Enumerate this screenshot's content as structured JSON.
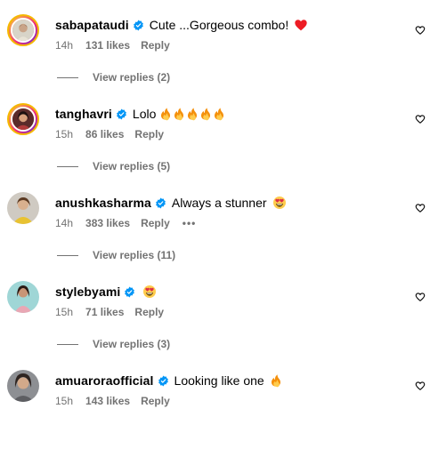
{
  "comments": [
    {
      "username": "sabapataudi",
      "text": "Cute ...Gorgeous combo!",
      "emojis": [
        "red-heart"
      ],
      "time": "14h",
      "likes": "131 likes",
      "reply": "Reply",
      "view_replies": "View replies (2)"
    },
    {
      "username": "tanghavri",
      "text": "Lolo",
      "emojis": [
        "fire",
        "fire",
        "fire",
        "fire",
        "fire"
      ],
      "time": "15h",
      "likes": "86 likes",
      "reply": "Reply",
      "view_replies": "View replies (5)"
    },
    {
      "username": "anushkasharma",
      "text": "Always a stunner",
      "emojis": [
        "heart-eyes"
      ],
      "time": "14h",
      "likes": "383 likes",
      "reply": "Reply",
      "more": "•••",
      "view_replies": "View replies (11)"
    },
    {
      "username": "stylebyami",
      "text": "",
      "emojis": [
        "heart-eyes"
      ],
      "time": "15h",
      "likes": "71 likes",
      "reply": "Reply",
      "view_replies": "View replies (3)"
    },
    {
      "username": "amuaroraofficial",
      "text": "Looking like one",
      "emojis": [
        "fire"
      ],
      "time": "15h",
      "likes": "143 likes",
      "reply": "Reply"
    }
  ],
  "colors": {
    "text": "#000000",
    "secondary": "#737373",
    "verified": "#0095f6",
    "heart": "#ed1c24"
  }
}
